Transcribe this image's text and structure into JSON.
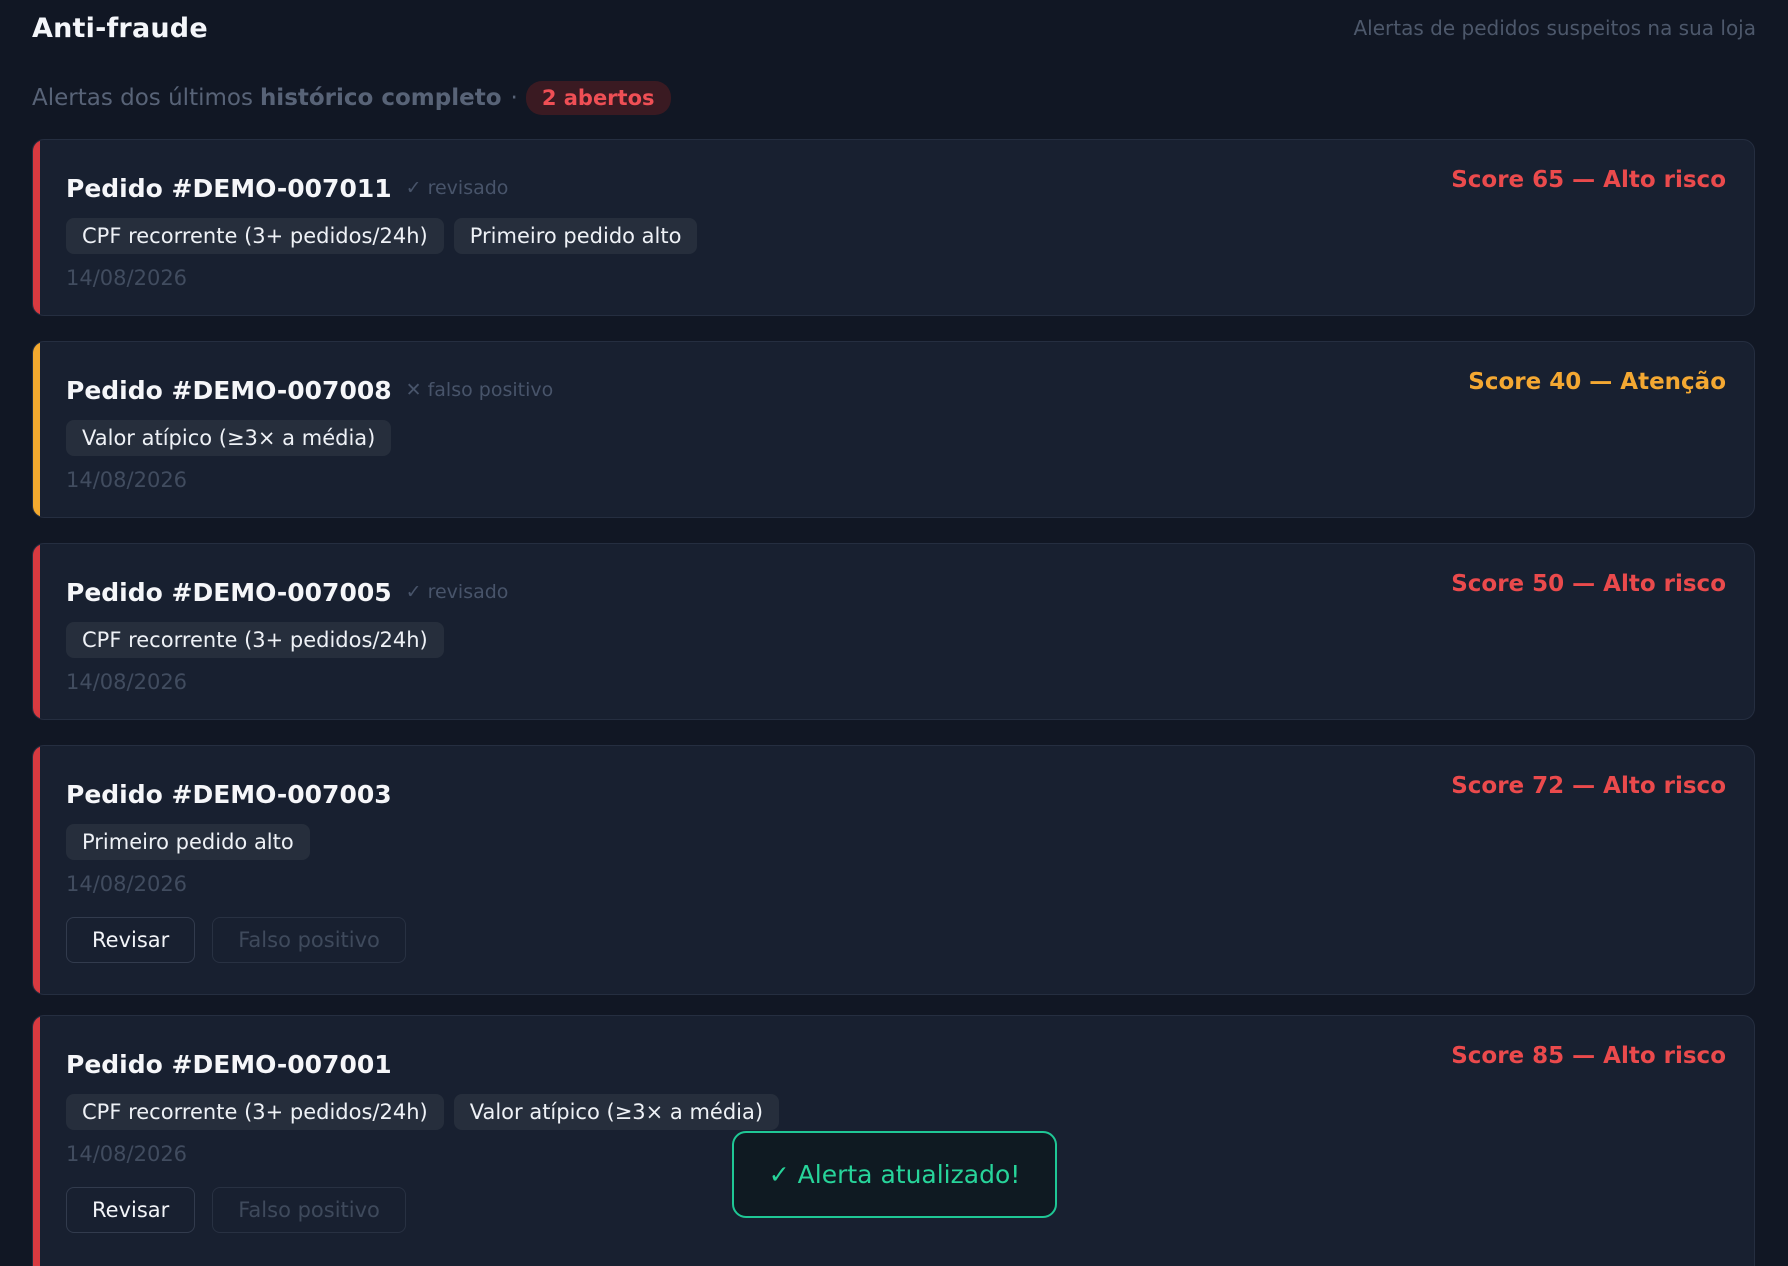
{
  "header": {
    "title": "Anti-fraude",
    "subtitle": "Alertas de pedidos suspeitos na sua loja"
  },
  "summary": {
    "prefix": "Alertas dos últimos",
    "period": "histórico completo",
    "separator": "·",
    "open_badge": "2 abertos"
  },
  "alerts": [
    {
      "order": "Pedido #DEMO-007011",
      "status": "✓ revisado",
      "score_text": "Score 65 — Alto risco",
      "score": 65,
      "risk": "Alto risco",
      "accent_color": "#d83a40",
      "tags": [
        "CPF recorrente (3+ pedidos/24h)",
        "Primeiro pedido alto"
      ],
      "date": "14/08/2026"
    },
    {
      "order": "Pedido #DEMO-007008",
      "status": "✕ falso positivo",
      "score_text": "Score 40 — Atenção",
      "score": 40,
      "risk": "Atenção",
      "accent_color": "#f3a92f",
      "tags": [
        "Valor atípico (≥3× a média)"
      ],
      "date": "14/08/2026"
    },
    {
      "order": "Pedido #DEMO-007005",
      "status": "✓ revisado",
      "score_text": "Score 50 — Alto risco",
      "score": 50,
      "risk": "Alto risco",
      "accent_color": "#d83a40",
      "tags": [
        "CPF recorrente (3+ pedidos/24h)"
      ],
      "date": "14/08/2026"
    },
    {
      "order": "Pedido #DEMO-007003",
      "status": "",
      "score_text": "Score 72 — Alto risco",
      "score": 72,
      "risk": "Alto risco",
      "accent_color": "#d83a40",
      "tags": [
        "Primeiro pedido alto"
      ],
      "date": "14/08/2026",
      "actions": {
        "review": "Revisar",
        "false_positive": "Falso positivo"
      }
    },
    {
      "order": "Pedido #DEMO-007001",
      "status": "",
      "score_text": "Score 85 — Alto risco",
      "score": 85,
      "risk": "Alto risco",
      "accent_color": "#d83a40",
      "tags": [
        "CPF recorrente (3+ pedidos/24h)",
        "Valor atípico (≥3× a média)"
      ],
      "date": "14/08/2026",
      "actions": {
        "review": "Revisar",
        "false_positive": "Falso positivo"
      }
    }
  ],
  "toast": {
    "icon": "✓",
    "message": "Alerta atualizado!"
  },
  "colors": {
    "background": "#111724",
    "card": "#182030",
    "high_risk": "#ea4a4c",
    "attention": "#f4a832",
    "success": "#27d49a"
  }
}
